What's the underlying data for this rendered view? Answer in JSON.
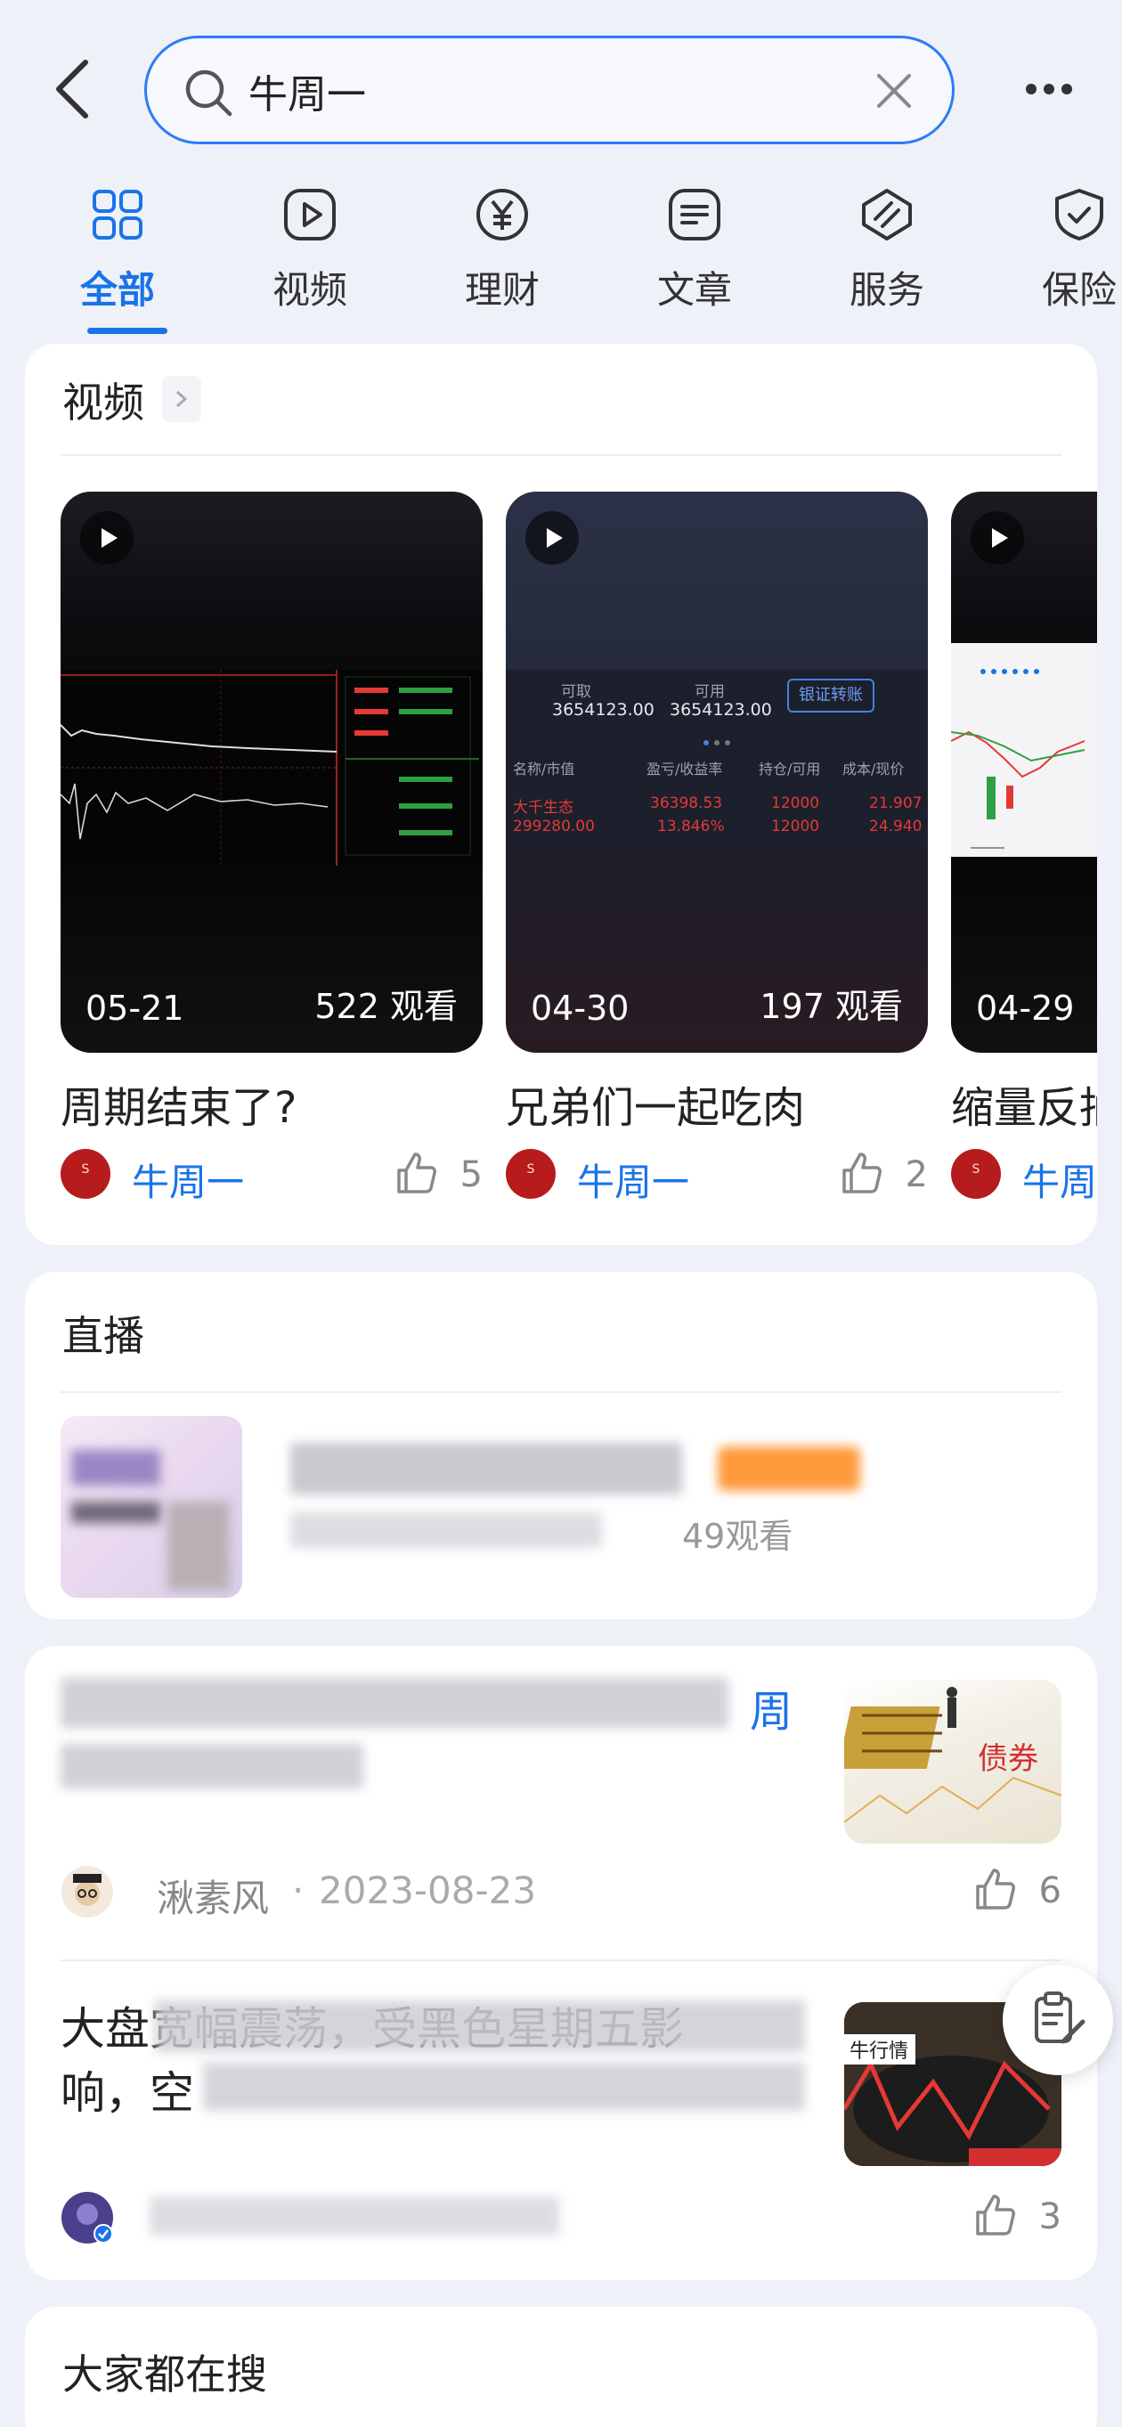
{
  "search": {
    "query": "牛周一"
  },
  "tabs": [
    {
      "label": "全部",
      "icon": "grid-icon",
      "active": true
    },
    {
      "label": "视频",
      "icon": "play-icon",
      "active": false
    },
    {
      "label": "理财",
      "icon": "yen-icon",
      "active": false
    },
    {
      "label": "文章",
      "icon": "article-icon",
      "active": false
    },
    {
      "label": "服务",
      "icon": "service-icon",
      "active": false
    },
    {
      "label": "保险",
      "icon": "shield-icon",
      "active": false
    }
  ],
  "videos": {
    "title": "视频",
    "items": [
      {
        "date": "05-21",
        "views": "522 观看",
        "title": "周期结束了?",
        "author": "牛周一",
        "likes": "5"
      },
      {
        "date": "04-30",
        "views": "197 观看",
        "title": "兄弟们一起吃肉",
        "author": "牛周一",
        "likes": "2",
        "overlay": {
          "available_label": "可取",
          "available_value": "3654123.00",
          "usable_label": "可用",
          "usable_value": "3654123.00",
          "transfer_button": "银证转账",
          "headers": [
            "名称/市值",
            "盈亏/收益率",
            "持仓/可用",
            "成本/现价"
          ],
          "rows": [
            [
              "大千生态",
              "36398.53",
              "12000",
              "21.907"
            ],
            [
              "299280.00",
              "13.846%",
              "12000",
              "24.940"
            ]
          ]
        }
      },
      {
        "date": "04-29",
        "views": "",
        "title": "缩量反抽",
        "author": "牛周一",
        "likes": ""
      }
    ]
  },
  "live": {
    "title": "直播",
    "views_suffix": "49观看"
  },
  "articles": [
    {
      "title_visible": "周",
      "author": "湫素风",
      "date": "2023-08-23",
      "likes": "6",
      "image_label": "债券"
    },
    {
      "title_line1": "大盘宽幅震荡，受黑色星期五影",
      "title_line2": "响，空",
      "author": "",
      "date": "",
      "likes": "3",
      "image_label": "牛行情"
    }
  ],
  "popular": {
    "title": "大家都在搜"
  },
  "colors": {
    "accent": "#1a73e8",
    "background": "#eef1f8",
    "up_red": "#e53935"
  }
}
